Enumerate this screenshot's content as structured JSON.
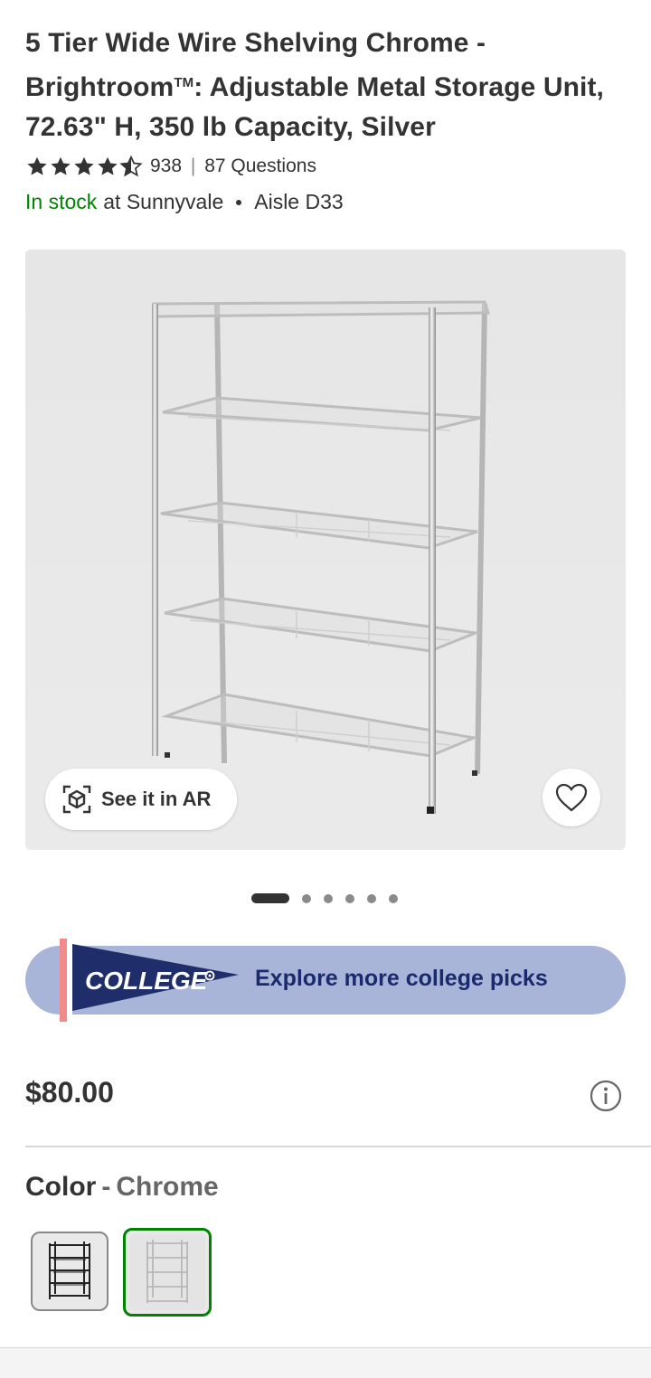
{
  "product": {
    "title_part1": "5 Tier Wide Wire Shelving Chrome - Brightroom",
    "title_tm": "TM",
    "title_part2": ": Adjustable Metal Storage Unit, 72.63\" H, 350 lb Capacity, Silver",
    "rating": {
      "stars": 4.5,
      "review_count": "938",
      "separator": "|",
      "questions": "87 Questions"
    },
    "stock": {
      "status": "In stock",
      "location": "at Sunnyvale",
      "aisle": "Aisle D33"
    },
    "image": {
      "alt": "chrome wire shelving unit",
      "ar_button_label": "See it in AR",
      "ar_icon": "ar-cube-icon",
      "favorite_icon": "heart-icon",
      "page_count": 6,
      "current_page": 1
    },
    "banner": {
      "pennant_text": "COLLEGE",
      "cta": "Explore more college picks"
    },
    "price": "$80.00",
    "info_icon": "info-icon",
    "color": {
      "label": "Color",
      "dash": "-",
      "value": "Chrome",
      "swatches": [
        {
          "name": "Black",
          "selected": false
        },
        {
          "name": "Chrome",
          "selected": true
        }
      ]
    }
  },
  "colors": {
    "in_stock_green": "#008300",
    "banner_bg": "#a8b5d8",
    "banner_text": "#1a2a6c",
    "text_primary": "#333333",
    "selected_swatch": "#008300"
  }
}
